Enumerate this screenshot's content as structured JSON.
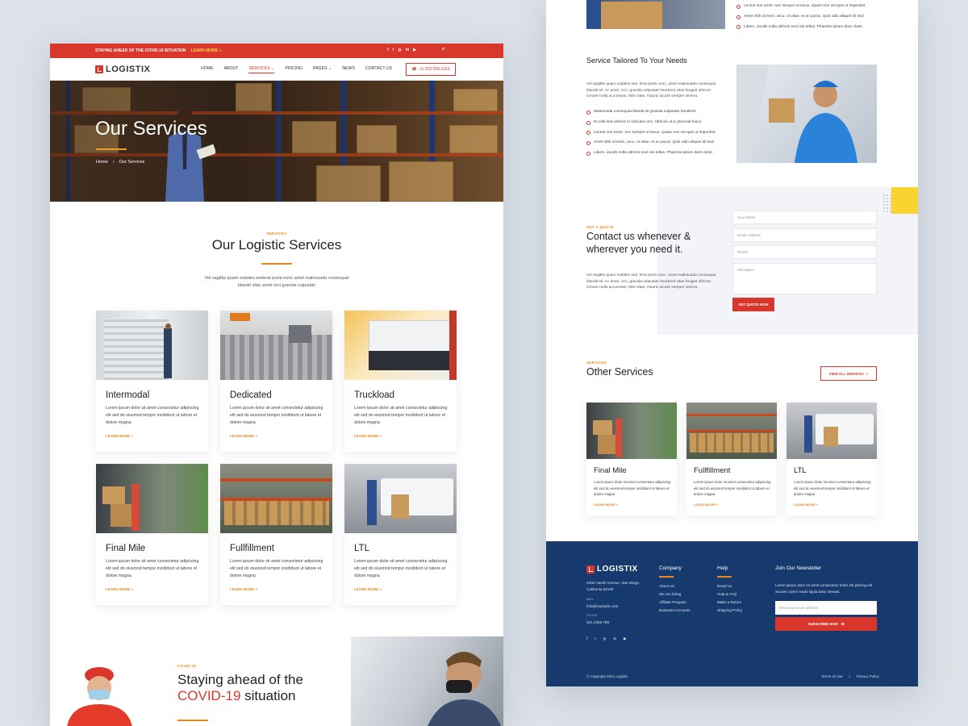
{
  "topbar": {
    "text": "STAYING AHEAD OF THE COVID-19 SITUATION",
    "link": "LEARN MORE"
  },
  "brand": {
    "name": "LOGISTIX",
    "accent": "#d9372b",
    "orange": "#e8891c",
    "navy": "#163a6d"
  },
  "nav": {
    "items": [
      "HOME",
      "ABOUT",
      "SERVICES",
      "PRICING",
      "PAGES",
      "NEWS",
      "CONTACT US"
    ],
    "phone": "+1-202-555-0119"
  },
  "hero": {
    "title": "Our Services",
    "crumb_home": "Home",
    "crumb_current": "Our Services"
  },
  "services": {
    "kicker": "SERVICES",
    "title": "Our Logistic Services",
    "desc_1": "Vel sagittis quam sodales sederat porta nunc amet malesuada consequat",
    "desc_2": "blandit sitac amet orci gravida vulpulate",
    "cards": [
      {
        "title": "Intermodal",
        "text": "Lorem ipsum dolor sit amet consectetur adipiscing elit sed do eiusmod tempor incididunt ut labore et dolore magna",
        "more": "LEARN MORE"
      },
      {
        "title": "Dedicated",
        "text": "Lorem ipsum dolor sit amet consectetur adipiscing elit sed do eiusmod tempor incididunt ut labore et dolore magna",
        "more": "LEARN MORE"
      },
      {
        "title": "Truckload",
        "text": "Lorem ipsum dolor sit amet consectetur adipiscing elit sed do eiusmod tempor incididunt ut labore et dolore magna",
        "more": "LEARN MORE"
      },
      {
        "title": "Final Mile",
        "text": "Lorem ipsum dolor sit amet consectetur adipiscing elit sed do eiusmod tempor incididunt ut labore et dolore magna",
        "more": "LEARN MORE"
      },
      {
        "title": "Fullfillment",
        "text": "Lorem ipsum dolor sit amet consectetur adipiscing elit sed do eiusmod tempor incididunt ut labore et dolore magna",
        "more": "LEARN MORE"
      },
      {
        "title": "LTL",
        "text": "Lorem ipsum dolor sit amet consectetur adipiscing elit sed do eiusmod tempor incididunt ut labore et dolore magna",
        "more": "LEARN MORE"
      }
    ]
  },
  "covid": {
    "kicker": "COVID 19",
    "title_1": "Staying ahead of the",
    "title_red": "COVID-19",
    "title_2": "situation"
  },
  "right_top_bullets": [
    "Lectus non tortor, nec semper ut lacus. Quam non vel quis ut imperdiet.",
    "Amet nibh id enim, arcu, ut vitae, et ac purus. Quis odio aliquet sit sed.",
    "Libero, iaculis nulla ultrices erat nisi tellus. Pharetra ipsum diam dolor."
  ],
  "tailored": {
    "title": "Service Tailored To Your Needs",
    "text": "Vel sagittis quam sodales sed. Erat porta nunc, amet malesuada consequat blandit sit. Ac amet, orci, gravida vulputate hendrerit vitae feugiat ultrices. Ornare nulla accumsan, felis vitae, mauris iaculis semper viverra.",
    "bullets": [
      "Malesuada consequat blandit sit gravida vulputate hendrerit",
      "Et velit sed ultrices in ridiculus orci. Ultrices ut in placerat fusce.",
      "Lectus non tortor, nec semper ut lacus. Quam non vel quis ut imperdiet.",
      "Amet nibh id enim, arcu, ut vitae, et ac purus. Quis odio aliquet sit sed.",
      "Libero, iaculis nulla ultrices erat nisi tellus. Pharetra ipsum diam dolor."
    ]
  },
  "quote": {
    "kicker": "GET A QUOTE",
    "title_1": "Contact us whenever &",
    "title_2": "wherever you need it.",
    "text": "Vel sagittis quam sodales sed. Erat porta nunc, amet malesuada consequat blandit sit. Ac amet, orci, gravida vulputate hendrerit vitae feugiat ultrices. Ornare nulla accumsan, felis vitae, mauris iaculis semper viverra.",
    "fields": {
      "name": "Your Name",
      "email": "Email Address",
      "phone": "Phone",
      "message": "Messages"
    },
    "button": "GET QUOTE NOW"
  },
  "other": {
    "kicker": "SERVICES",
    "title": "Other Services",
    "view_all": "VIEW ALL SERVICES",
    "cards": [
      {
        "title": "Final Mile",
        "text": "Lorem ipsum dolor sit amet consectetur adipiscing elit sed do eiusmod tempor incididunt ut labore et dolore magna",
        "more": "LEARN MORE"
      },
      {
        "title": "Fullfillment",
        "text": "Lorem ipsum dolor sit amet consectetur adipiscing elit sed do eiusmod tempor incididunt ut labore et dolore magna",
        "more": "LEARN MORE"
      },
      {
        "title": "LTL",
        "text": "Lorem ipsum dolor sit amet consectetur adipiscing elit sed do eiusmod tempor incididunt ut labore et dolore magna",
        "more": "LEARN MORE"
      }
    ]
  },
  "footer": {
    "address_1": "4200 Hamill Avenue, San Diego,",
    "address_2": "California 92109",
    "mail_label": "MAIL",
    "mail": "info@example.com",
    "phone_label": "PHONE",
    "phone": "021 3456 789",
    "company_title": "Company",
    "company_links": [
      "About Us",
      "We are hiring",
      "Affiliate Program",
      "Business Accounts"
    ],
    "help_title": "Help",
    "help_links": [
      "Email Us",
      "Help & FAQ",
      "Make a Return",
      "Shipping Policy"
    ],
    "newsletter_title": "Join Our Newsletter",
    "newsletter_text": "Lorem ipsum dolor sit amet consectetur tellus elit placing elit secoen comm modo ligula dolor senean.",
    "newsletter_placeholder": "Enter your email address",
    "subscribe": "SUBSCRIBE NOW",
    "copyright": "© Copyright 2021 Logistix",
    "terms": "Terms of Use",
    "privacy": "Privacy Policy"
  }
}
